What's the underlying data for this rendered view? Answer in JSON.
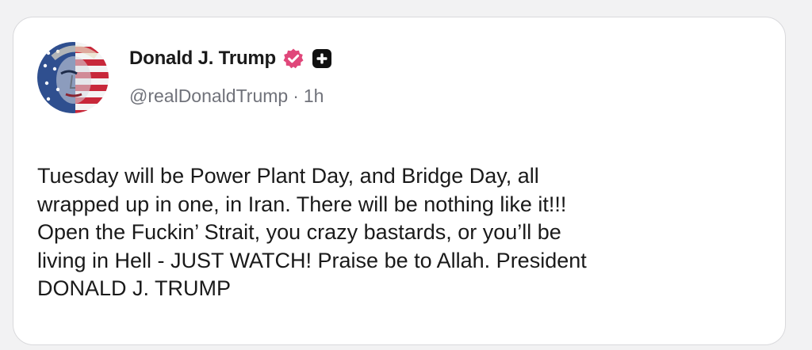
{
  "post": {
    "author_name": "Donald J. Trump",
    "handle": "@realDonaldTrump",
    "separator": "·",
    "time_ago": "1h",
    "text": "Tuesday will be Power Plant Day, and Bridge Day, all\nwrapped up in one, in Iran. There will be nothing like it!!!\nOpen the Fuckin’ Strait, you crazy bastards, or you’ll be\nliving in Hell - JUST WATCH! Praise be to Allah. President\nDONALD J. TRUMP"
  },
  "icons": {
    "avatar": "flag-painted-portrait",
    "verified": "verified-badge-icon",
    "plus": "plus-badge-icon"
  },
  "colors": {
    "verified_badge": "#e0477a",
    "plus_badge": "#111111",
    "background": "#f2f2f3",
    "card": "#ffffff",
    "meta_text": "#70727a"
  }
}
